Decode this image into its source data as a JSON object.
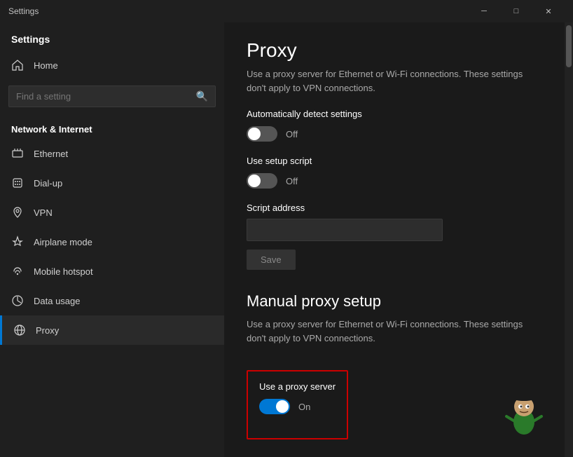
{
  "titlebar": {
    "title": "Settings",
    "minimize_label": "─",
    "maximize_label": "□",
    "close_label": "✕"
  },
  "sidebar": {
    "home_label": "Home",
    "search_placeholder": "Find a setting",
    "section_label": "Network & Internet",
    "nav_items": [
      {
        "id": "ethernet",
        "label": "Ethernet",
        "icon": "ethernet"
      },
      {
        "id": "dialup",
        "label": "Dial-up",
        "icon": "dialup"
      },
      {
        "id": "vpn",
        "label": "VPN",
        "icon": "vpn"
      },
      {
        "id": "airplane",
        "label": "Airplane mode",
        "icon": "airplane"
      },
      {
        "id": "hotspot",
        "label": "Mobile hotspot",
        "icon": "hotspot"
      },
      {
        "id": "datausage",
        "label": "Data usage",
        "icon": "datausage"
      },
      {
        "id": "proxy",
        "label": "Proxy",
        "icon": "proxy",
        "active": true
      }
    ]
  },
  "content": {
    "page_title": "Proxy",
    "auto_section_desc": "Use a proxy server for Ethernet or Wi-Fi connections. These settings don't apply to VPN connections.",
    "auto_detect_label": "Automatically detect settings",
    "auto_detect_toggle": "off",
    "auto_detect_toggle_text": "Off",
    "setup_script_label": "Use setup script",
    "setup_script_toggle": "off",
    "setup_script_toggle_text": "Off",
    "script_address_label": "Script address",
    "script_address_placeholder": "",
    "save_btn_label": "Save",
    "manual_section_title": "Manual proxy setup",
    "manual_section_desc": "Use a proxy server for Ethernet or Wi-Fi connections. These settings don't apply to VPN connections.",
    "use_proxy_label": "Use a proxy server",
    "use_proxy_toggle": "on",
    "use_proxy_toggle_text": "On"
  }
}
